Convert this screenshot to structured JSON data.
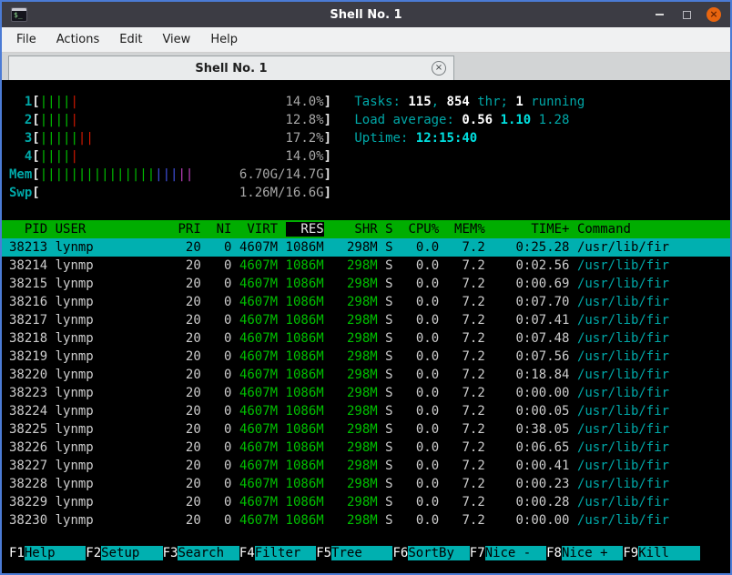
{
  "window": {
    "title": "Shell No. 1",
    "icon_glyph": "$_",
    "close_glyph": "×"
  },
  "menu": {
    "items": [
      "File",
      "Actions",
      "Edit",
      "View",
      "Help"
    ]
  },
  "tab": {
    "label": "Shell No. 1",
    "close_glyph": "×"
  },
  "htop": {
    "meters": [
      {
        "label": "1",
        "segments": [
          [
            "green",
            4
          ],
          [
            "red",
            1
          ]
        ],
        "value": "14.0%"
      },
      {
        "label": "2",
        "segments": [
          [
            "green",
            4
          ],
          [
            "red",
            1
          ]
        ],
        "value": "12.8%"
      },
      {
        "label": "3",
        "segments": [
          [
            "green",
            5
          ],
          [
            "red",
            2
          ]
        ],
        "value": "17.2%"
      },
      {
        "label": "4",
        "segments": [
          [
            "green",
            4
          ],
          [
            "red",
            1
          ]
        ],
        "value": "14.0%"
      },
      {
        "label": "Mem",
        "segments": [
          [
            "green",
            15
          ],
          [
            "blue",
            3
          ],
          [
            "magenta",
            2
          ]
        ],
        "value": "6.70G/14.7G"
      },
      {
        "label": "Swp",
        "segments": [],
        "value": "1.26M/16.6G"
      }
    ],
    "summary_lines": [
      [
        [
          "cyan",
          "Tasks: "
        ],
        [
          "bold",
          "115"
        ],
        [
          "cyan",
          ", "
        ],
        [
          "bold",
          "854"
        ],
        [
          "cyan",
          " thr; "
        ],
        [
          "bold",
          "1"
        ],
        [
          "cyan",
          " running"
        ]
      ],
      [
        [
          "cyan",
          "Load average: "
        ],
        [
          "bold",
          "0.56 "
        ],
        [
          "bcyanb",
          "1.10 "
        ],
        [
          "cyan",
          "1.28"
        ]
      ],
      [
        [
          "cyan",
          "Uptime: "
        ],
        [
          "bcyanb",
          "12:15:40"
        ]
      ]
    ],
    "table": {
      "columns": [
        [
          "PID",
          5,
          "r"
        ],
        [
          "USER",
          15,
          "l"
        ],
        [
          "PRI",
          3,
          "r"
        ],
        [
          "NI",
          3,
          "r"
        ],
        [
          "VIRT",
          5,
          "r"
        ],
        [
          "RES",
          5,
          "r"
        ],
        [
          "SHR",
          6,
          "r"
        ],
        [
          "S",
          1,
          "l"
        ],
        [
          "CPU%",
          5,
          "r"
        ],
        [
          "MEM%",
          5,
          "r"
        ],
        [
          "TIME+",
          10,
          "r"
        ],
        [
          "Command",
          0,
          "l"
        ]
      ],
      "sort_column": "RES",
      "selected_pid": "38213",
      "col_colors": {
        "VIRT": "green",
        "RES": "green",
        "SHR": "green",
        "Command": "cyan"
      },
      "rows": [
        [
          "38213",
          "lynmp",
          "20",
          "0",
          "4607M",
          "1086M",
          "298M",
          "S",
          "0.0",
          "7.2",
          "0:25.28",
          "/usr/lib/fir"
        ],
        [
          "38214",
          "lynmp",
          "20",
          "0",
          "4607M",
          "1086M",
          "298M",
          "S",
          "0.0",
          "7.2",
          "0:02.56",
          "/usr/lib/fir"
        ],
        [
          "38215",
          "lynmp",
          "20",
          "0",
          "4607M",
          "1086M",
          "298M",
          "S",
          "0.0",
          "7.2",
          "0:00.69",
          "/usr/lib/fir"
        ],
        [
          "38216",
          "lynmp",
          "20",
          "0",
          "4607M",
          "1086M",
          "298M",
          "S",
          "0.0",
          "7.2",
          "0:07.70",
          "/usr/lib/fir"
        ],
        [
          "38217",
          "lynmp",
          "20",
          "0",
          "4607M",
          "1086M",
          "298M",
          "S",
          "0.0",
          "7.2",
          "0:07.41",
          "/usr/lib/fir"
        ],
        [
          "38218",
          "lynmp",
          "20",
          "0",
          "4607M",
          "1086M",
          "298M",
          "S",
          "0.0",
          "7.2",
          "0:07.48",
          "/usr/lib/fir"
        ],
        [
          "38219",
          "lynmp",
          "20",
          "0",
          "4607M",
          "1086M",
          "298M",
          "S",
          "0.0",
          "7.2",
          "0:07.56",
          "/usr/lib/fir"
        ],
        [
          "38220",
          "lynmp",
          "20",
          "0",
          "4607M",
          "1086M",
          "298M",
          "S",
          "0.0",
          "7.2",
          "0:18.84",
          "/usr/lib/fir"
        ],
        [
          "38223",
          "lynmp",
          "20",
          "0",
          "4607M",
          "1086M",
          "298M",
          "S",
          "0.0",
          "7.2",
          "0:00.00",
          "/usr/lib/fir"
        ],
        [
          "38224",
          "lynmp",
          "20",
          "0",
          "4607M",
          "1086M",
          "298M",
          "S",
          "0.0",
          "7.2",
          "0:00.05",
          "/usr/lib/fir"
        ],
        [
          "38225",
          "lynmp",
          "20",
          "0",
          "4607M",
          "1086M",
          "298M",
          "S",
          "0.0",
          "7.2",
          "0:38.05",
          "/usr/lib/fir"
        ],
        [
          "38226",
          "lynmp",
          "20",
          "0",
          "4607M",
          "1086M",
          "298M",
          "S",
          "0.0",
          "7.2",
          "0:06.65",
          "/usr/lib/fir"
        ],
        [
          "38227",
          "lynmp",
          "20",
          "0",
          "4607M",
          "1086M",
          "298M",
          "S",
          "0.0",
          "7.2",
          "0:00.41",
          "/usr/lib/fir"
        ],
        [
          "38228",
          "lynmp",
          "20",
          "0",
          "4607M",
          "1086M",
          "298M",
          "S",
          "0.0",
          "7.2",
          "0:00.23",
          "/usr/lib/fir"
        ],
        [
          "38229",
          "lynmp",
          "20",
          "0",
          "4607M",
          "1086M",
          "298M",
          "S",
          "0.0",
          "7.2",
          "0:00.28",
          "/usr/lib/fir"
        ],
        [
          "38230",
          "lynmp",
          "20",
          "0",
          "4607M",
          "1086M",
          "298M",
          "S",
          "0.0",
          "7.2",
          "0:00.00",
          "/usr/lib/fir"
        ]
      ]
    },
    "fkeys": [
      [
        "F1",
        "Help"
      ],
      [
        "F2",
        "Setup"
      ],
      [
        "F3",
        "Search"
      ],
      [
        "F4",
        "Filter"
      ],
      [
        "F5",
        "Tree"
      ],
      [
        "F6",
        "SortBy"
      ],
      [
        "F7",
        "Nice -"
      ],
      [
        "F8",
        "Nice +"
      ],
      [
        "F9",
        "Kill"
      ]
    ]
  },
  "colors": {
    "cyan": "#00a8a8",
    "bright-cyan": "#00e0e0",
    "green": "#00c000",
    "red": "#d01800",
    "blue": "#4050e0",
    "magenta": "#c040c0",
    "header-bg": "#00ad00",
    "sel-bg": "#00b0b0",
    "fg": "#cdcdcd",
    "border-blue": "#4b7bd5",
    "titlebar-bg": "#3c3c44",
    "close-bg": "#e8650f"
  }
}
